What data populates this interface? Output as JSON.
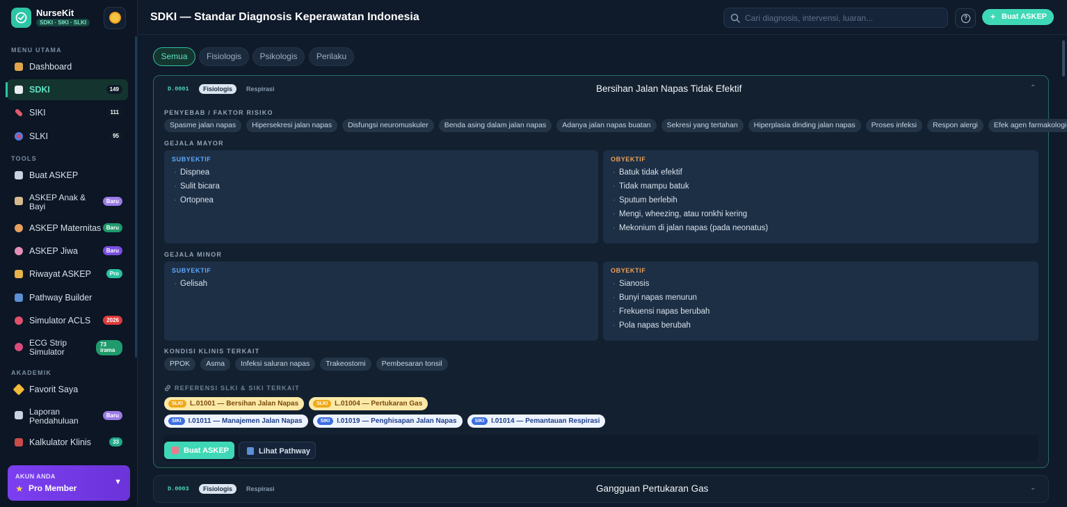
{
  "app": {
    "name": "NurseKit",
    "subtitle": "SDKI · SIKI · SLKI"
  },
  "sidebar": {
    "sections": [
      {
        "title": "MENU UTAMA"
      },
      {
        "title": "TOOLS"
      },
      {
        "title": "AKADEMIK"
      }
    ],
    "items": [
      {
        "label": "Dashboard",
        "icon": "home-icon",
        "badge": ""
      },
      {
        "label": "SDKI",
        "icon": "clipboard-icon",
        "badge": "149",
        "active": true
      },
      {
        "label": "SIKI",
        "icon": "syringe-icon",
        "badge": "111"
      },
      {
        "label": "SLKI",
        "icon": "target-icon",
        "badge": "95"
      },
      {
        "label": "Buat ASKEP",
        "icon": "document-icon",
        "badge": ""
      },
      {
        "label": "ASKEP Anak & Bayi",
        "icon": "pacifier-icon",
        "badge": "Baru"
      },
      {
        "label": "ASKEP Maternitas",
        "icon": "pregnant-icon",
        "badge": "Baru"
      },
      {
        "label": "ASKEP Jiwa",
        "icon": "brain-icon",
        "badge": "Baru"
      },
      {
        "label": "Riwayat ASKEP",
        "icon": "folder-icon",
        "badge": "Pro"
      },
      {
        "label": "Pathway Builder",
        "icon": "map-icon",
        "badge": ""
      },
      {
        "label": "Simulator ACLS",
        "icon": "heart-icon",
        "badge": "2026"
      },
      {
        "label": "ECG Strip Simulator",
        "icon": "heartbeat-icon",
        "badge": "73 irama"
      },
      {
        "label": "Favorit Saya",
        "icon": "star-icon",
        "badge": ""
      },
      {
        "label": "Laporan Pendahuluan",
        "icon": "report-icon",
        "badge": "Baru"
      },
      {
        "label": "Kalkulator Klinis",
        "icon": "calculator-icon",
        "badge": "33"
      }
    ],
    "account": {
      "label": "AKUN ANDA",
      "name": "Pro Member"
    }
  },
  "header": {
    "title": "SDKI — Standar Diagnosis Keperawatan Indonesia",
    "search_placeholder": "Cari diagnosis, intervensi, luaran...",
    "help_label": "?",
    "cta_label": "Buat ASKEP"
  },
  "filters": [
    "Semua",
    "Fisiologis",
    "Psikologis",
    "Perilaku"
  ],
  "diagnoses": [
    {
      "code": "D.0001",
      "category": "Fisiologis",
      "subcategory": "Respirasi",
      "title": "Bersihan Jalan Napas Tidak Efektif",
      "causes_label": "PENYEBAB / FAKTOR RISIKO",
      "causes": [
        "Spasme jalan napas",
        "Hipersekresi jalan napas",
        "Disfungsi neuromuskuler",
        "Benda asing dalam jalan napas",
        "Adanya jalan napas buatan",
        "Sekresi yang tertahan",
        "Hiperplasia dinding jalan napas",
        "Proses infeksi",
        "Respon alergi",
        "Efek agen farmakologis"
      ],
      "major_label": "GEJALA MAYOR",
      "minor_label": "GEJALA MINOR",
      "subjective_label": "SUBYEKTIF",
      "objective_label": "OBYEKTIF",
      "major_subjective": [
        "Dispnea",
        "Sulit bicara",
        "Ortopnea"
      ],
      "major_objective": [
        "Batuk tidak efektif",
        "Tidak mampu batuk",
        "Sputum berlebih",
        "Mengi, wheezing, atau ronkhi kering",
        "Mekonium di jalan napas (pada neonatus)"
      ],
      "minor_subjective": [
        "Gelisah"
      ],
      "minor_objective": [
        "Sianosis",
        "Bunyi napas menurun",
        "Frekuensi napas berubah",
        "Pola napas berubah"
      ],
      "conditions_label": "KONDISI KLINIS TERKAIT",
      "conditions": [
        "PPOK",
        "Asma",
        "Infeksi saluran napas",
        "Trakeostomi",
        "Pembesaran tonsil"
      ],
      "refs_label": "REFERENSI SLKI & SIKI TERKAIT",
      "refs_slki": [
        {
          "tag": "SLKI",
          "label": "L.01001 — Bersihan Jalan Napas"
        },
        {
          "tag": "SLKI",
          "label": "L.01004 — Pertukaran Gas"
        }
      ],
      "refs_siki": [
        {
          "tag": "SIKI",
          "label": "I.01011 — Manajemen Jalan Napas"
        },
        {
          "tag": "SIKI",
          "label": "I.01019 — Penghisapan Jalan Napas"
        },
        {
          "tag": "SIKI",
          "label": "I.01014 — Pemantauan Respirasi"
        }
      ],
      "actions": {
        "primary": "Buat ASKEP",
        "secondary": "Lihat Pathway"
      }
    },
    {
      "code": "D.0003",
      "category": "Fisiologis",
      "subcategory": "Respirasi",
      "title": "Gangguan Pertukaran Gas"
    }
  ],
  "colors": {
    "accent": "#2ec4a6",
    "background": "#0f1a2a",
    "card": "#13202f",
    "panel": "#1d2f45",
    "pro_purple": "#7b3ff0"
  }
}
